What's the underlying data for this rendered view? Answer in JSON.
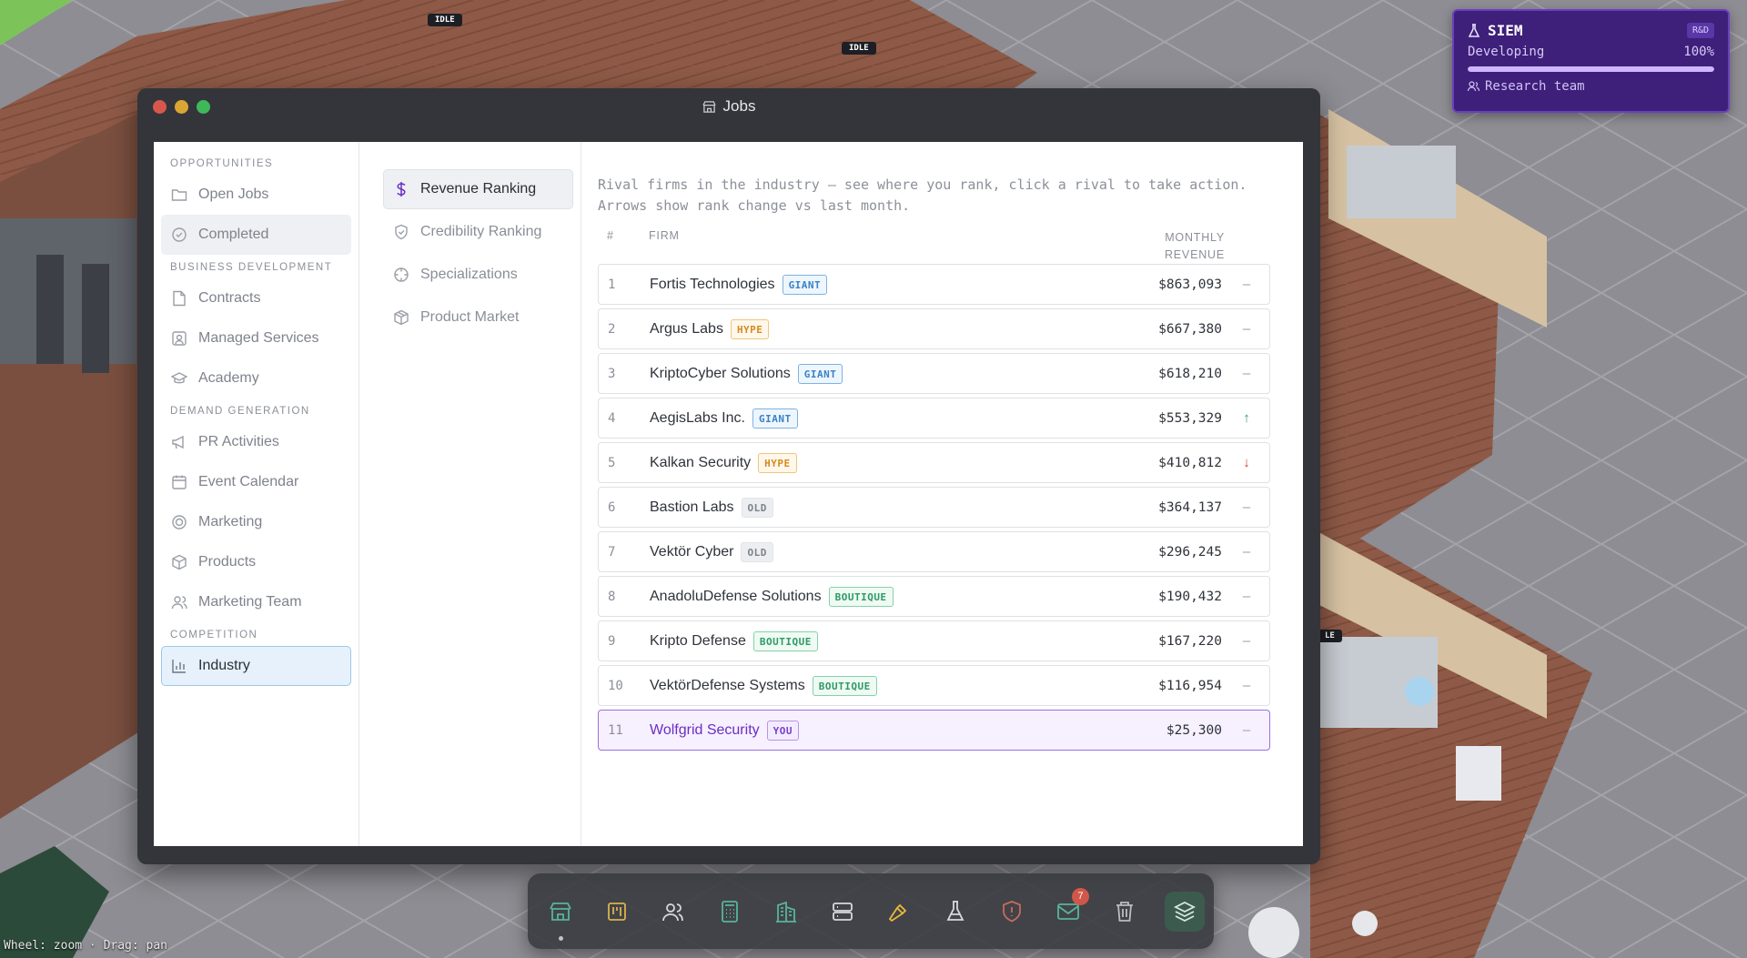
{
  "scene": {
    "hint": "Wheel: zoom · Drag: pan",
    "idle_labels": [
      "IDLE",
      "IDLE",
      "LE"
    ]
  },
  "siem_widget": {
    "title": "SIEM",
    "badge": "R&D",
    "status": "Developing",
    "progress_text": "100%",
    "progress": 1.0,
    "team": "Research team"
  },
  "window": {
    "title": "Jobs",
    "icon": "store-icon"
  },
  "sidebar": {
    "sections": [
      {
        "label": "OPPORTUNITIES",
        "items": [
          {
            "label": "Open Jobs",
            "icon": "folder-icon"
          },
          {
            "label": "Completed",
            "icon": "check-circle-icon"
          }
        ]
      },
      {
        "label": "BUSINESS DEVELOPMENT",
        "items": [
          {
            "label": "Contracts",
            "icon": "document-icon"
          },
          {
            "label": "Managed Services",
            "icon": "managed-services-icon"
          },
          {
            "label": "Academy",
            "icon": "graduation-cap-icon"
          }
        ]
      },
      {
        "label": "DEMAND GENERATION",
        "items": [
          {
            "label": "PR Activities",
            "icon": "megaphone-icon"
          },
          {
            "label": "Event Calendar",
            "icon": "calendar-icon"
          },
          {
            "label": "Marketing",
            "icon": "target-icon"
          },
          {
            "label": "Products",
            "icon": "box-icon"
          },
          {
            "label": "Marketing Team",
            "icon": "users-icon"
          }
        ]
      },
      {
        "label": "COMPETITION",
        "items": [
          {
            "label": "Industry",
            "icon": "bar-chart-icon"
          }
        ]
      }
    ]
  },
  "submenu": {
    "items": [
      {
        "label": "Revenue Ranking",
        "icon": "dollar-icon"
      },
      {
        "label": "Credibility Ranking",
        "icon": "shield-check-icon"
      },
      {
        "label": "Specializations",
        "icon": "crosshair-icon"
      },
      {
        "label": "Product Market",
        "icon": "package-icon"
      }
    ]
  },
  "main": {
    "description": "Rival firms in the industry — see where you rank, click a rival to take action. Arrows show rank change vs last month.",
    "columns": {
      "rank": "#",
      "firm": "FIRM",
      "revenue_line1": "MONTHLY",
      "revenue_line2": "REVENUE"
    },
    "rows": [
      {
        "rank": "1",
        "firm": "Fortis Technologies",
        "tag": "GIANT",
        "revenue": "$863,093",
        "trend": "–"
      },
      {
        "rank": "2",
        "firm": "Argus Labs",
        "tag": "HYPE",
        "revenue": "$667,380",
        "trend": "–"
      },
      {
        "rank": "3",
        "firm": "KriptoCyber Solutions",
        "tag": "GIANT",
        "revenue": "$618,210",
        "trend": "–"
      },
      {
        "rank": "4",
        "firm": "AegisLabs Inc.",
        "tag": "GIANT",
        "revenue": "$553,329",
        "trend": "↑"
      },
      {
        "rank": "5",
        "firm": "Kalkan Security",
        "tag": "HYPE",
        "revenue": "$410,812",
        "trend": "↓"
      },
      {
        "rank": "6",
        "firm": "Bastion Labs",
        "tag": "OLD",
        "revenue": "$364,137",
        "trend": "–"
      },
      {
        "rank": "7",
        "firm": "Vektör Cyber",
        "tag": "OLD",
        "revenue": "$296,245",
        "trend": "–"
      },
      {
        "rank": "8",
        "firm": "AnadoluDefense Solutions",
        "tag": "BOUTIQUE",
        "revenue": "$190,432",
        "trend": "–"
      },
      {
        "rank": "9",
        "firm": "Kripto Defense",
        "tag": "BOUTIQUE",
        "revenue": "$167,220",
        "trend": "–"
      },
      {
        "rank": "10",
        "firm": "VektörDefense Systems",
        "tag": "BOUTIQUE",
        "revenue": "$116,954",
        "trend": "–"
      },
      {
        "rank": "11",
        "firm": "Wolfgrid Security",
        "tag": "YOU",
        "revenue": "$25,300",
        "trend": "–"
      }
    ]
  },
  "dock": {
    "items": [
      {
        "icon": "store-icon"
      },
      {
        "icon": "kanban-icon"
      },
      {
        "icon": "users-icon"
      },
      {
        "icon": "calculator-icon"
      },
      {
        "icon": "building-icon"
      },
      {
        "icon": "server-icon"
      },
      {
        "icon": "hammer-icon"
      },
      {
        "icon": "flask-icon"
      },
      {
        "icon": "shield-alert-icon"
      },
      {
        "icon": "mail-icon",
        "badge": "7"
      },
      {
        "icon": "trash-icon"
      },
      {
        "icon": "layers-icon"
      }
    ]
  },
  "colors": {
    "accent_purple": "#6a2fc2",
    "window_frame": "#33353a",
    "active_blue": "#e6f1fb",
    "siem_bg": "#3e1f7a"
  }
}
